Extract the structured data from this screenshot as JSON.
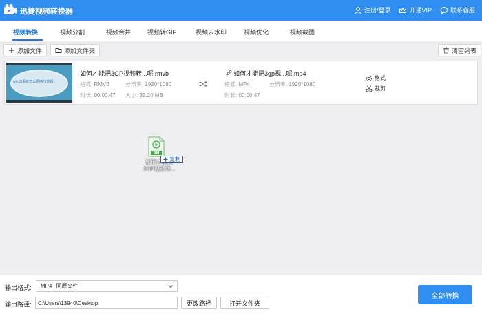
{
  "app": {
    "title": "迅捷视频转换器"
  },
  "title_actions": [
    {
      "icon": "user-icon",
      "label": "注册/登录"
    },
    {
      "icon": "crown-icon",
      "label": "开通VIP"
    },
    {
      "icon": "chat-icon",
      "label": "联系客服"
    }
  ],
  "tabs": [
    "视频转换",
    "视频分割",
    "视频合并",
    "视频转GIF",
    "视频去水印",
    "视频优化",
    "视频截图"
  ],
  "active_tab": "视频转换",
  "toolbar": {
    "add_file": "添加文件",
    "add_folder": "添加文件夹",
    "clear_list": "清空列表"
  },
  "file": {
    "thumb_text": "win10系统怎么把MP3音频..",
    "source": {
      "name": "如何才能把3GP视频转...呢.rmvb",
      "format_label": "格式:",
      "format": "RMVB",
      "resolution_label": "分辨率:",
      "resolution": "1920*1080",
      "duration_label": "时长:",
      "duration": "00:00:47",
      "size_label": "大小:",
      "size": "32.24 MB"
    },
    "target": {
      "name": "如何才能把3gp视...呢.mp4",
      "format_label": "格式:",
      "format": "MP4",
      "resolution_label": "分辨率:",
      "resolution": "1920*1080",
      "duration_label": "时长:",
      "duration": "00:00:47"
    },
    "actions": {
      "format": "格式",
      "cut": "裁剪"
    }
  },
  "drag": {
    "file_tag": "RM",
    "filename_line1": "如何才能把",
    "filename_line2": "3GP视频转...",
    "copy_label": "复制"
  },
  "output": {
    "format_label": "输出格式:",
    "format_value": "MP4",
    "format_quality": "同原文件",
    "path_label": "输出路径:",
    "path_value": "C:\\Users\\13940\\Desktop",
    "change_path": "更改路径",
    "open_folder": "打开文件夹",
    "convert_all": "全部转换"
  },
  "colors": {
    "accent": "#2f8ef0",
    "active_tab": "#1f7ae0",
    "background": "#efeef1"
  }
}
